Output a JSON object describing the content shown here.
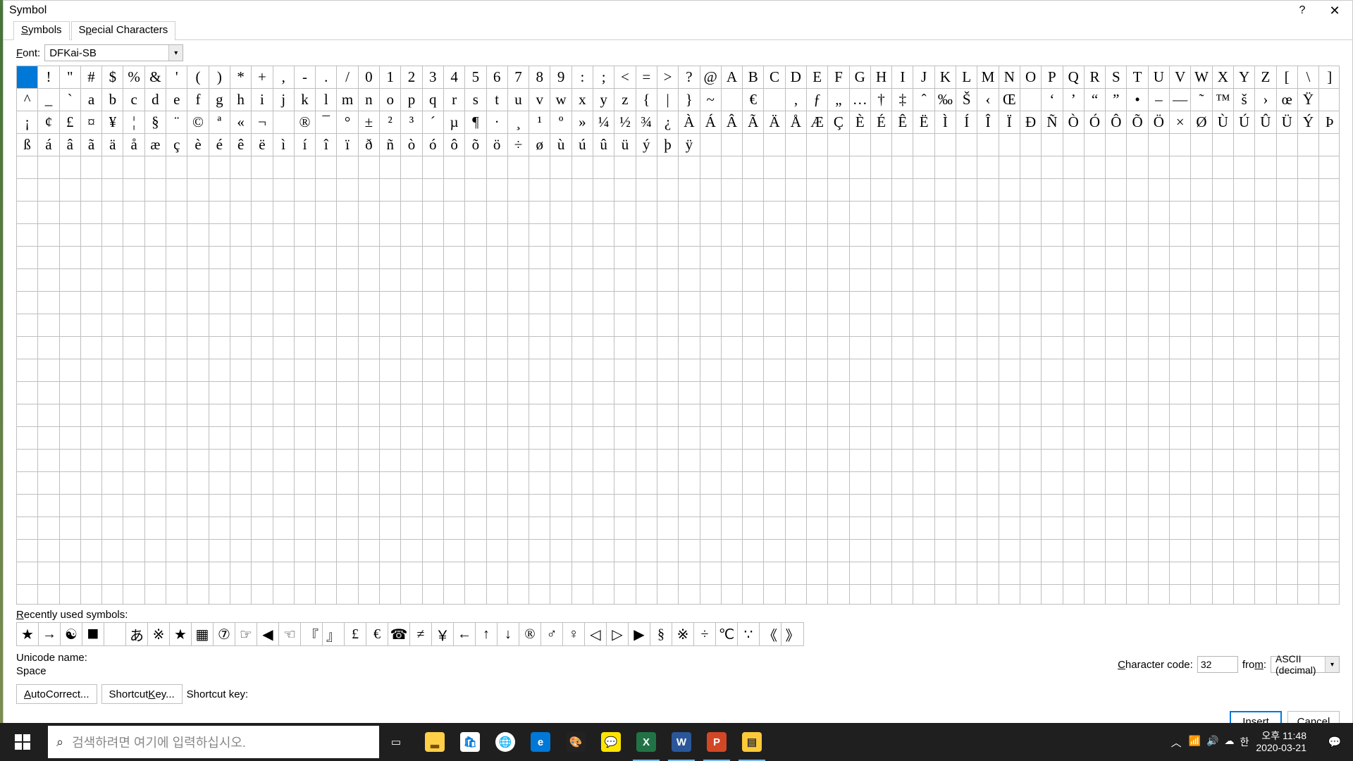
{
  "dialog": {
    "title": "Symbol",
    "tabs": {
      "symbols": "Symbols",
      "special": "Special Characters"
    },
    "font_label": "Font:",
    "font_value": "DFKai-SB",
    "grid_rows": [
      [
        " ",
        "!",
        "\"",
        "#",
        "$",
        "%",
        "&",
        "'",
        "(",
        ")",
        "*",
        "+",
        ",",
        "-",
        ".",
        "/",
        "0",
        "1",
        "2",
        "3",
        "4",
        "5",
        "6",
        "7",
        "8",
        "9",
        ":",
        ";",
        "<",
        "=",
        ">",
        "?",
        "@",
        "A",
        "B",
        "C",
        "D",
        "E",
        "F",
        "G",
        "H",
        "I",
        "J",
        "K",
        "L",
        "M",
        "N",
        "O",
        "P",
        "Q",
        "R",
        "S",
        "T",
        "U",
        "V",
        "W",
        "X",
        "Y",
        "Z",
        "[",
        "\\",
        "]"
      ],
      [
        "^",
        "_",
        "`",
        "a",
        "b",
        "c",
        "d",
        "e",
        "f",
        "g",
        "h",
        "i",
        "j",
        "k",
        "l",
        "m",
        "n",
        "o",
        "p",
        "q",
        "r",
        "s",
        "t",
        "u",
        "v",
        "w",
        "x",
        "y",
        "z",
        "{",
        "|",
        "}",
        "~",
        " ",
        "€",
        " ",
        "‚",
        "ƒ",
        "„",
        "…",
        "†",
        "‡",
        "ˆ",
        "‰",
        "Š",
        "‹",
        "Œ",
        " ",
        "‘",
        "’",
        "“",
        "”",
        "•",
        "–",
        "—",
        "˜",
        "™",
        "š",
        "›",
        "œ",
        "Ÿ",
        " "
      ],
      [
        "¡",
        "¢",
        "£",
        "¤",
        "¥",
        "¦",
        "§",
        "¨",
        "©",
        "ª",
        "«",
        "¬",
        " ",
        "®",
        "¯",
        "°",
        "±",
        "²",
        "³",
        "´",
        "µ",
        "¶",
        "·",
        "¸",
        "¹",
        "º",
        "»",
        "¼",
        "½",
        "¾",
        "¿",
        "À",
        "Á",
        "Â",
        "Ã",
        "Ä",
        "Å",
        "Æ",
        "Ç",
        "È",
        "É",
        "Ê",
        "Ë",
        "Ì",
        "Í",
        "Î",
        "Ï",
        "Ð",
        "Ñ",
        "Ò",
        "Ó",
        "Ô",
        "Õ",
        "Ö",
        "×",
        "Ø",
        "Ù",
        "Ú",
        "Û",
        "Ü",
        "Ý",
        "Þ"
      ],
      [
        "ß",
        "á",
        "â",
        "ã",
        "ä",
        "å",
        "æ",
        "ç",
        "è",
        "é",
        "ê",
        "ë",
        "ì",
        "í",
        "î",
        "ï",
        "ð",
        "ñ",
        "ò",
        "ó",
        "ô",
        "õ",
        "ö",
        "÷",
        "ø",
        "ù",
        "ú",
        "û",
        "ü",
        "ý",
        "þ",
        "ÿ",
        "",
        "",
        "",
        "",
        "",
        "",
        "",
        "",
        "",
        "",
        "",
        "",
        "",
        "",
        "",
        "",
        "",
        "",
        "",
        "",
        "",
        "",
        "",
        "",
        "",
        "",
        "",
        "",
        "",
        ""
      ]
    ],
    "empty_rows": 20,
    "recent_label": "Recently used symbols:",
    "recent": [
      "★",
      "→",
      "☯",
      "■",
      " ",
      "あ",
      "※",
      "★",
      "▦",
      "⑦",
      "☞",
      "◀",
      "☜",
      "『",
      "』",
      "£",
      "€",
      "☎",
      "≠",
      "￥",
      "←",
      "↑",
      "↓",
      "®",
      "♂",
      "♀",
      "◁",
      "▷",
      "▶",
      "§",
      "※",
      "÷",
      "℃",
      "∵",
      "《",
      "》"
    ],
    "unicode_name_label": "Unicode name:",
    "unicode_name_value": "Space",
    "char_code_label": "Character code:",
    "char_code_value": "32",
    "from_label": "from:",
    "from_value": "ASCII (decimal)",
    "autocorrect": "AutoCorrect...",
    "shortcut_key_btn": "Shortcut Key...",
    "shortcut_label": "Shortcut key:",
    "insert": "Insert",
    "cancel": "Cancel"
  },
  "taskbar": {
    "search_placeholder": "검색하려면 여기에 입력하십시오.",
    "clock_time": "오후 11:48",
    "clock_date": "2020-03-21"
  }
}
